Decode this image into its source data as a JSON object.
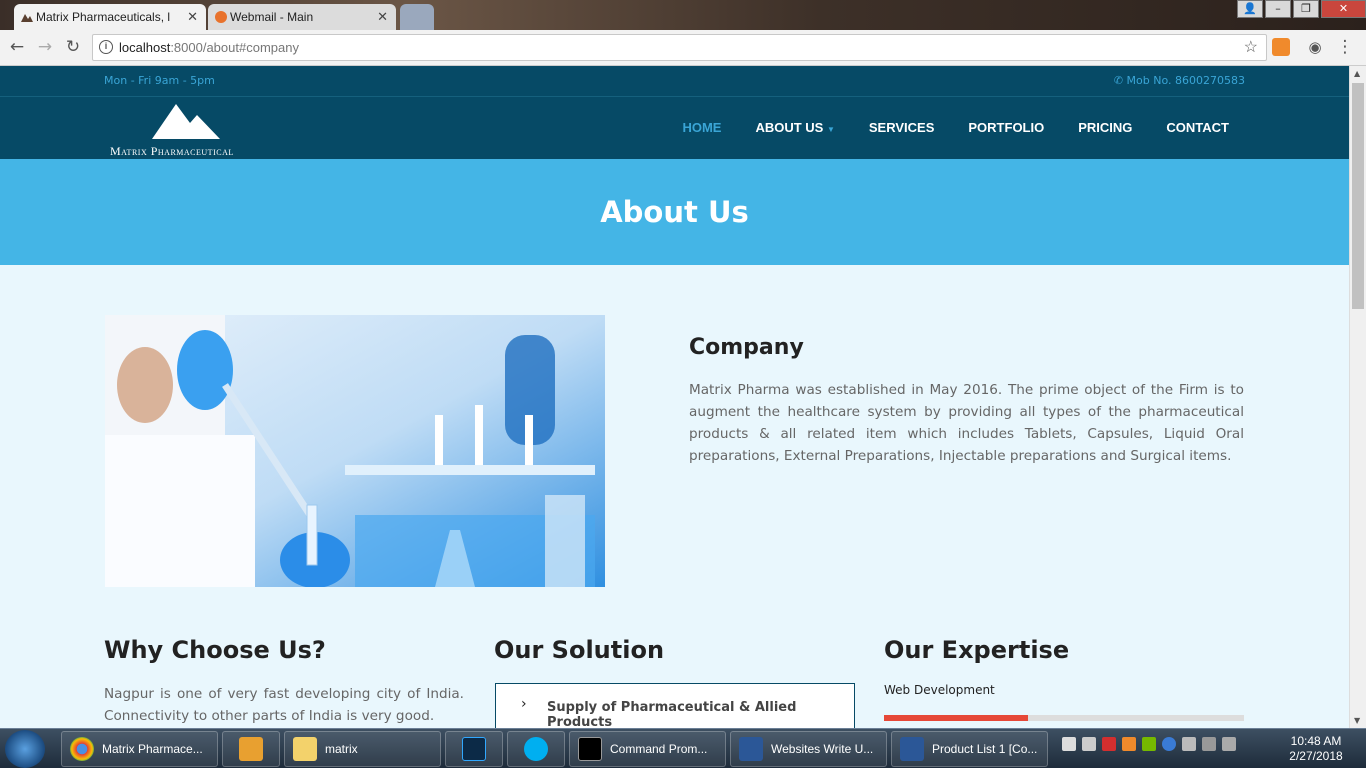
{
  "browser": {
    "tabs": [
      {
        "title": "Matrix Pharmaceuticals, l",
        "active": true
      },
      {
        "title": "Webmail - Main",
        "active": false
      }
    ],
    "url_host": "localhost",
    "url_path": ":8000/about#company"
  },
  "site": {
    "topbar": {
      "hours": "Mon - Fri 9am - 5pm",
      "phone": "Mob No. 8600270583"
    },
    "logo_text": "Matrix Pharmaceutical",
    "menu": [
      "HOME",
      "ABOUT US",
      "SERVICES",
      "PORTFOLIO",
      "PRICING",
      "CONTACT"
    ],
    "hero_title": "About Us",
    "company": {
      "heading": "Company",
      "text": "Matrix Pharma was established in May 2016. The prime object of the Firm is to augment the healthcare system by providing all types of the pharmaceutical products & all related item which includes Tablets, Capsules, Liquid Oral preparations, External Preparations, Injectable preparations and Surgical items."
    },
    "why": {
      "heading": "Why Choose Us?",
      "text": "Nagpur is one of very fast developing city of India. Connectivity to other parts of India is very good."
    },
    "solution": {
      "heading": "Our Solution",
      "item": "Supply of Pharmaceutical & Allied Products"
    },
    "expertise": {
      "heading": "Our Expertise",
      "skill": "Web Development",
      "skill_level": 0.4
    },
    "accent_color": "#3aa5d6",
    "header_color": "#064a66"
  },
  "taskbar": {
    "items": [
      {
        "label": "Matrix Pharmace...",
        "icon": "chrome-icon"
      },
      {
        "label": "",
        "icon": "media-player-icon"
      },
      {
        "label": "matrix",
        "icon": "folder-icon"
      },
      {
        "label": "",
        "icon": "photoshop-icon"
      },
      {
        "label": "",
        "icon": "skype-icon"
      },
      {
        "label": "Command Prom...",
        "icon": "cmd-icon"
      },
      {
        "label": "Websites Write U...",
        "icon": "word-icon"
      },
      {
        "label": "Product List 1 [Co...",
        "icon": "word-icon"
      }
    ],
    "time": "10:48 AM",
    "date": "2/27/2018"
  }
}
